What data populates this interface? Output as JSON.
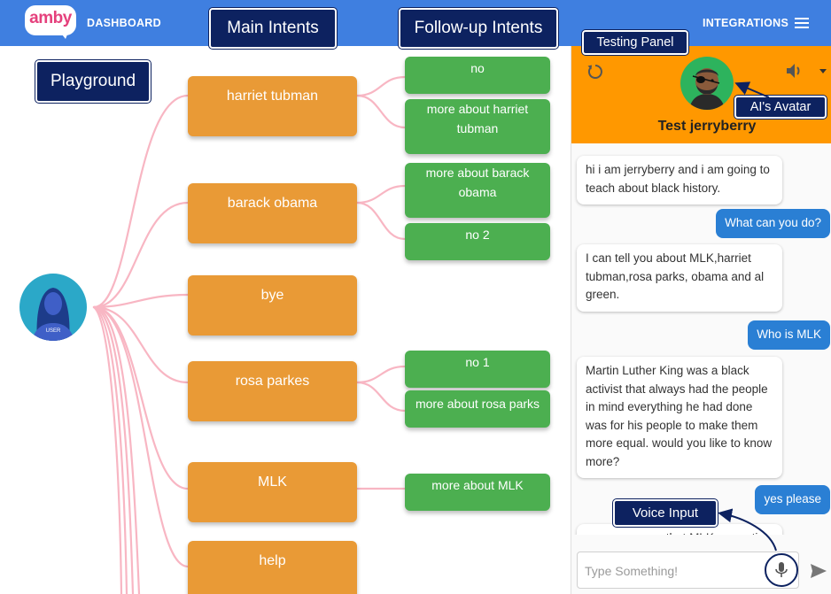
{
  "header": {
    "logo_text": "amby",
    "nav": {
      "dashboard": "DASHBOARD",
      "integrations": "INTEGRATIONS"
    }
  },
  "annotations": {
    "main_intents": "Main Intents",
    "followup_intents": "Follow-up Intents",
    "playground": "Playground",
    "testing_panel": "Testing Panel",
    "ai_avatar": "AI's Avatar",
    "voice_input": "Voice Input"
  },
  "user_node": {
    "label": "USER"
  },
  "intents": [
    {
      "label": "harriet tubman",
      "followups": [
        "no",
        "more about harriet tubman"
      ]
    },
    {
      "label": "barack obama",
      "followups": [
        "more about barack obama",
        "no 2"
      ]
    },
    {
      "label": "bye",
      "followups": []
    },
    {
      "label": "rosa parkes",
      "followups": [
        "no 1",
        "more about rosa parks"
      ]
    },
    {
      "label": "MLK",
      "followups": [
        "more about MLK"
      ]
    },
    {
      "label": "help",
      "followups": []
    }
  ],
  "panel": {
    "bot_name": "Test jerryberry",
    "messages": [
      {
        "from": "bot",
        "text": "hi i am jerryberry and i am going to teach about black history."
      },
      {
        "from": "user",
        "text": "What can you do?"
      },
      {
        "from": "bot",
        "text": "I can tell you about MLK,harriet tubman,rosa parks, obama and al green."
      },
      {
        "from": "user",
        "text": "Who is MLK"
      },
      {
        "from": "bot",
        "text": "Martin Luther King was a black activist that always had the people in mind everything he had done was for his people to make them more equal. would you like to know more?"
      },
      {
        "from": "user",
        "text": "yes please"
      },
      {
        "from": "bot",
        "text": "everyone says that MLK or martin"
      }
    ],
    "input_placeholder": "Type Something!"
  },
  "colors": {
    "topbar": "#3f7fe0",
    "annotation": "#0d2260",
    "intent": "#e99a36",
    "followup": "#4caf50",
    "panel_header": "#ff9800",
    "user_bubble": "#2a7fd4",
    "connector": "#f8b6c3"
  },
  "icons": [
    "menu-icon",
    "refresh-icon",
    "volume-icon",
    "dropdown-caret-icon",
    "microphone-icon",
    "send-icon"
  ]
}
